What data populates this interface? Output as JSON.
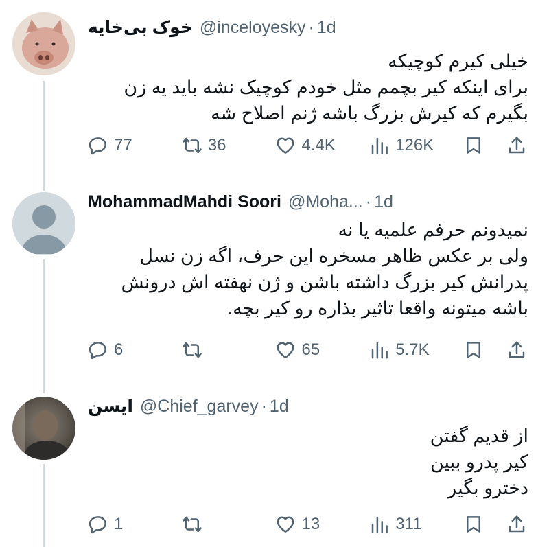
{
  "tweets": [
    {
      "name": "خوک بی‌خایه",
      "handle": "@inceloyesky",
      "time": "1d",
      "text": "خیلی کیرم کوچیکه\nبرای اینکه کیر بچمم مثل خودم کوچیک نشه باید یه زن\nبگیرم که کیرش بزرگ باشه ژنم اصلاح شه",
      "avatar": "pig-avatar",
      "stats": {
        "replies": "77",
        "retweets": "36",
        "likes": "4.4K",
        "views": "126K"
      }
    },
    {
      "name": "MohammadMahdi Soori",
      "handle": "@Moha...",
      "time": "1d",
      "text": "نمیدونم حرفم علمیه یا نه\nولی بر عکس ظاهر مسخره این حرف، اگه زن نسل\nپدرانش کیر بزرگ داشته باشن و ژن نهفته اش درونش\nباشه میتونه واقعا تاثیر بذاره رو کیر بچه.",
      "avatar": "default-avatar",
      "stats": {
        "replies": "6",
        "retweets": "",
        "likes": "65",
        "views": "5.7K"
      }
    },
    {
      "name": "ایسن",
      "handle": "@Chief_garvey",
      "time": "1d",
      "text": "از قدیم گفتن\nکیر پدرو ببین\nدخترو بگیر",
      "avatar": "blurred-photo-avatar",
      "stats": {
        "replies": "1",
        "retweets": "",
        "likes": "13",
        "views": "311"
      }
    }
  ],
  "colors": {
    "text": "#0f1419",
    "muted": "#536471",
    "thread_line": "#cfd9de",
    "pig": "#d9a89a"
  }
}
